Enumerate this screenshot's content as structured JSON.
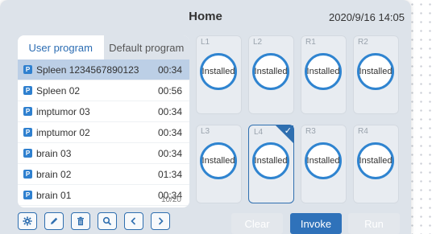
{
  "header": {
    "title": "Home",
    "datetime": "2020/9/16 14:05"
  },
  "tabs": [
    {
      "label": "User program",
      "active": true
    },
    {
      "label": "Default program",
      "active": false
    }
  ],
  "programs": [
    {
      "name": "Spleen 1234567890123",
      "time": "00:34",
      "selected": true
    },
    {
      "name": "Spleen 02",
      "time": "00:56"
    },
    {
      "name": "imptumor 03",
      "time": "00:34"
    },
    {
      "name": "imptumor 02",
      "time": "00:34"
    },
    {
      "name": "brain 03",
      "time": "00:34"
    },
    {
      "name": "brain 02",
      "time": "01:34"
    },
    {
      "name": "brain 01",
      "time": "00:34"
    }
  ],
  "program_badge": "P",
  "pagination": "10/20",
  "toolbar_icons": [
    "gear-icon",
    "pencil-icon",
    "trash-icon",
    "search-icon",
    "chevron-left-icon",
    "chevron-right-icon"
  ],
  "slots": [
    {
      "label": "L1",
      "status": "Installed"
    },
    {
      "label": "L2",
      "status": "Installed"
    },
    {
      "label": "R1",
      "status": "Installed"
    },
    {
      "label": "R2",
      "status": "Installed"
    },
    {
      "label": "L3",
      "status": "Installed"
    },
    {
      "label": "L4",
      "status": "Installed",
      "selected": true
    },
    {
      "label": "R3",
      "status": "Installed"
    },
    {
      "label": "R4",
      "status": "Installed"
    }
  ],
  "actions": {
    "clear": {
      "label": "Clear",
      "enabled": false
    },
    "invoke": {
      "label": "Invoke",
      "enabled": true
    },
    "run": {
      "label": "Run",
      "enabled": false
    }
  },
  "colors": {
    "accent": "#2f72ba",
    "ring": "#2f84d0",
    "selected_row": "#bccfe6",
    "background": "#dde3ea"
  }
}
